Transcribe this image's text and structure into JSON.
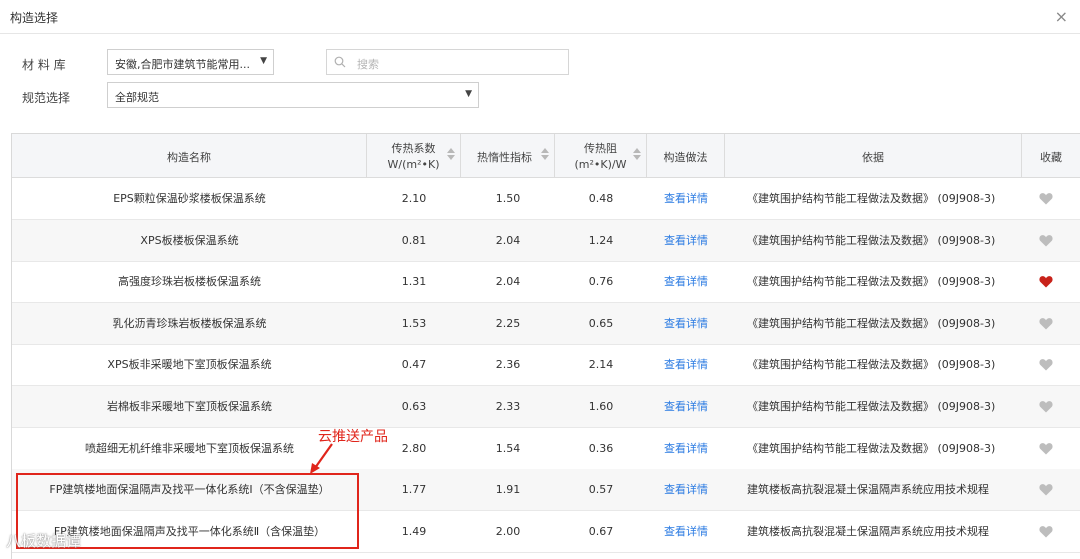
{
  "window": {
    "title": "构造选择",
    "close_glyph": "×"
  },
  "filters": {
    "material_label": "材 料 库",
    "material_value": "安徽,合肥市建筑节能常用...",
    "standard_label": "规范选择",
    "standard_value": "全部规范",
    "search_placeholder": "搜索"
  },
  "table": {
    "headers": {
      "name": "构造名称",
      "k_line1": "传热系数",
      "k_line2": "W/(m²•K)",
      "inertia": "热惰性指标",
      "r_line1": "传热阻",
      "r_line2": "(m²•K)/W",
      "method": "构造做法",
      "basis": "依据",
      "fav": "收藏"
    },
    "rows": [
      {
        "name": "EPS颗粒保温砂浆楼板保温系统",
        "k": "2.10",
        "inertia": "1.50",
        "r": "0.48",
        "method": "查看详情",
        "basis": "《建筑围护结构节能工程做法及数据》 (09J908-3)",
        "favorited": false
      },
      {
        "name": "XPS板楼板保温系统",
        "k": "0.81",
        "inertia": "2.04",
        "r": "1.24",
        "method": "查看详情",
        "basis": "《建筑围护结构节能工程做法及数据》 (09J908-3)",
        "favorited": false
      },
      {
        "name": "高强度珍珠岩板楼板保温系统",
        "k": "1.31",
        "inertia": "2.04",
        "r": "0.76",
        "method": "查看详情",
        "basis": "《建筑围护结构节能工程做法及数据》 (09J908-3)",
        "favorited": true
      },
      {
        "name": "乳化沥青珍珠岩板楼板保温系统",
        "k": "1.53",
        "inertia": "2.25",
        "r": "0.65",
        "method": "查看详情",
        "basis": "《建筑围护结构节能工程做法及数据》 (09J908-3)",
        "favorited": false
      },
      {
        "name": "XPS板非采暖地下室顶板保温系统",
        "k": "0.47",
        "inertia": "2.36",
        "r": "2.14",
        "method": "查看详情",
        "basis": "《建筑围护结构节能工程做法及数据》 (09J908-3)",
        "favorited": false
      },
      {
        "name": "岩棉板非采暖地下室顶板保温系统",
        "k": "0.63",
        "inertia": "2.33",
        "r": "1.60",
        "method": "查看详情",
        "basis": "《建筑围护结构节能工程做法及数据》 (09J908-3)",
        "favorited": false
      },
      {
        "name": "喷超细无机纤维非采暖地下室顶板保温系统",
        "k": "2.80",
        "inertia": "1.54",
        "r": "0.36",
        "method": "查看详情",
        "basis": "《建筑围护结构节能工程做法及数据》 (09J908-3)",
        "favorited": false
      },
      {
        "name": "FP建筑楼地面保温隔声及找平一体化系统Ⅰ（不含保温垫）",
        "k": "1.77",
        "inertia": "1.91",
        "r": "0.57",
        "method": "查看详情",
        "basis": "建筑楼板高抗裂混凝土保温隔声系统应用技术规程",
        "favorited": false
      },
      {
        "name": "FP建筑楼地面保温隔声及找平一体化系统Ⅱ（含保温垫）",
        "k": "1.49",
        "inertia": "2.00",
        "r": "0.67",
        "method": "查看详情",
        "basis": "建筑楼板高抗裂混凝土保温隔声系统应用技术规程",
        "favorited": false
      }
    ]
  },
  "annotation": {
    "label": "云推送产品"
  },
  "watermark": "八板数据谭",
  "colors": {
    "link": "#2a7ae2",
    "heart_on": "#c8221a",
    "heart_off": "#bdbdbd",
    "annotation": "#e0251b"
  }
}
